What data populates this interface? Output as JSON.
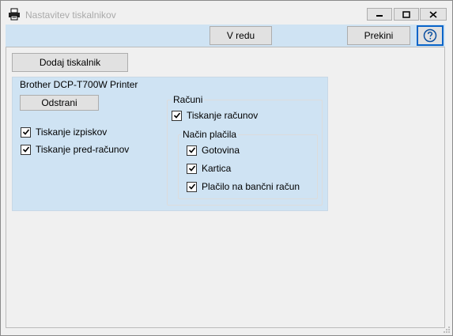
{
  "window": {
    "title": "Nastavitev tiskalnikov"
  },
  "toolbar": {
    "ok_label": "V redu",
    "cancel_label": "Prekini",
    "help_icon": "question-circle-icon"
  },
  "main": {
    "add_printer_label": "Dodaj tiskalnik",
    "printer": {
      "name": "Brother DCP-T700W Printer",
      "remove_label": "Odstrani",
      "print_receipts": {
        "label": "Tiskanje izpiskov",
        "checked": true
      },
      "print_pre_invoices": {
        "label": "Tiskanje pred-računov",
        "checked": true
      },
      "invoices_group": {
        "label": "Računi",
        "print_invoices": {
          "label": "Tiskanje računov",
          "checked": true
        },
        "payment_group": {
          "label": "Način plačila",
          "options": [
            {
              "label": "Gotovina",
              "checked": true
            },
            {
              "label": "Kartica",
              "checked": true
            },
            {
              "label": "Plačilo na bančni račun",
              "checked": true
            }
          ]
        }
      }
    }
  },
  "colors": {
    "panel_bg": "#cfe3f3",
    "focus_border": "#0a64c8",
    "window_bg": "#f0f0f0"
  }
}
